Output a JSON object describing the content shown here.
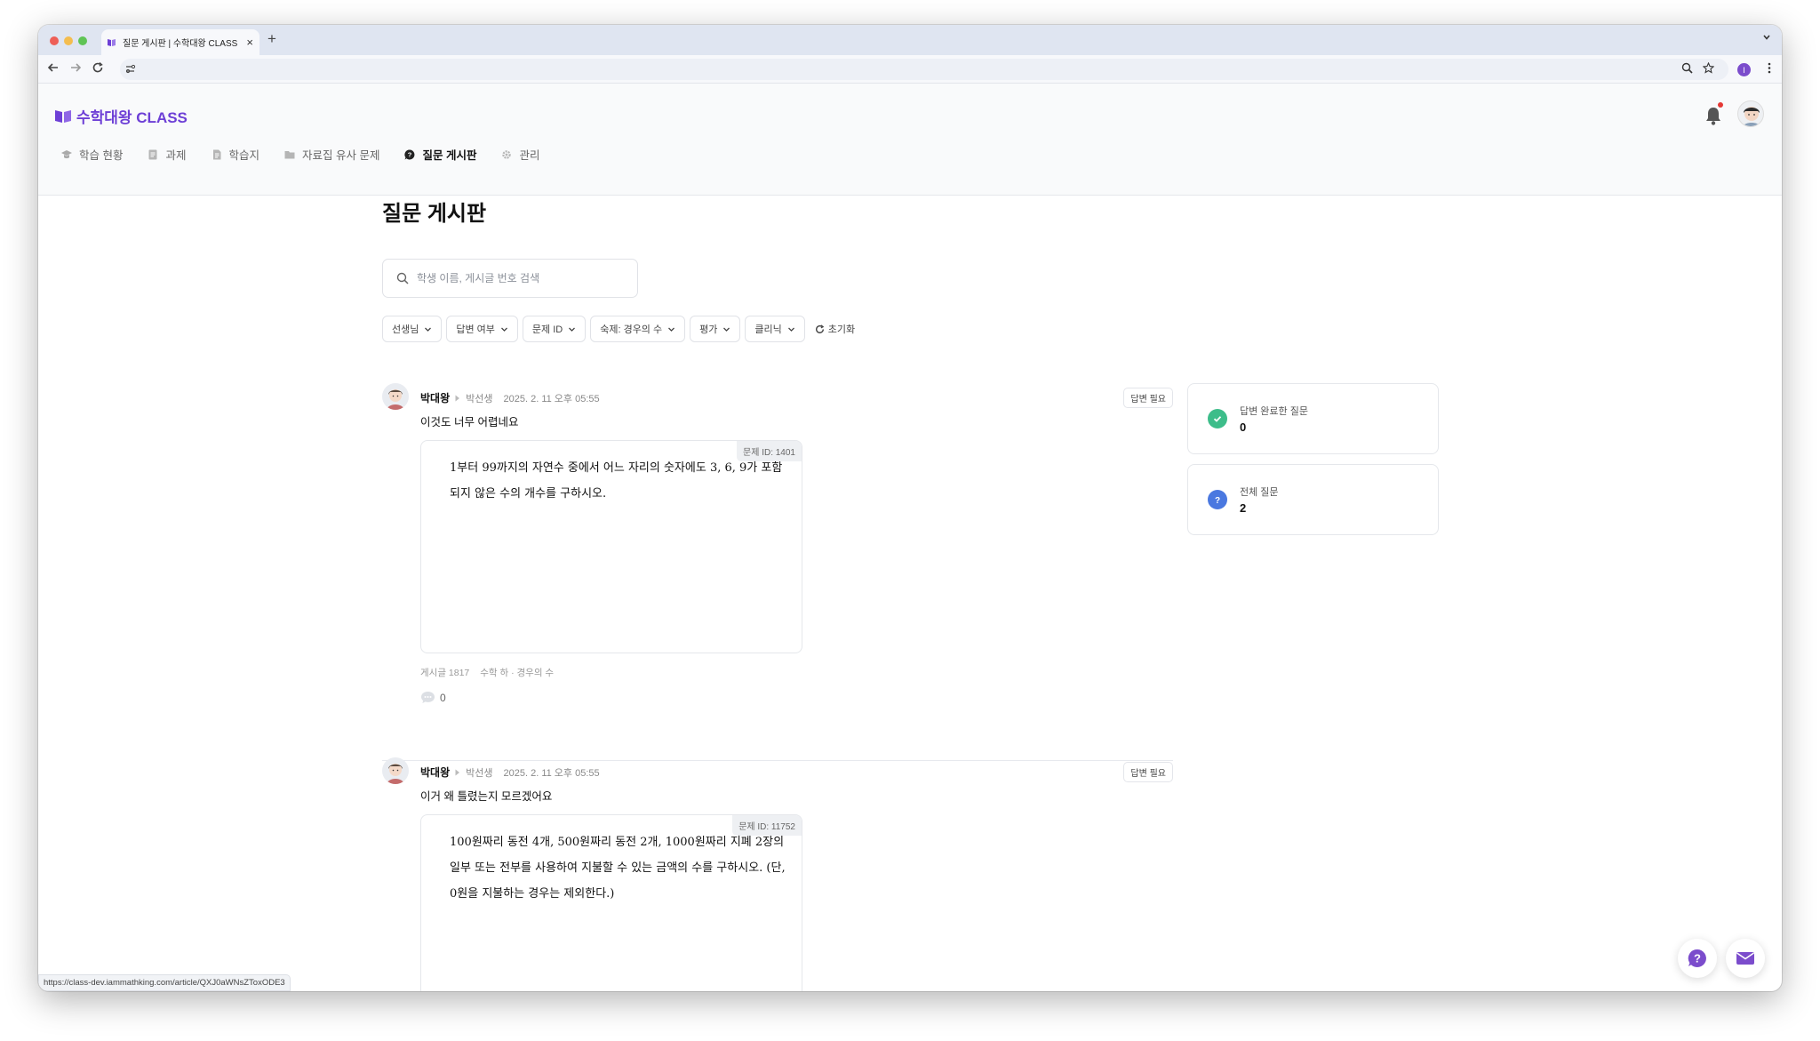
{
  "browser": {
    "tab_title": "질문 게시판 | 수학대왕 CLASS",
    "close_glyph": "×",
    "new_tab_glyph": "+",
    "status_url": "https://class-dev.iammathking.com/article/QXJ0aWNsZToxODE3",
    "profile_initial": "I"
  },
  "app": {
    "logo_text": "수학대왕 CLASS",
    "brand_color": "#6d3fd6",
    "nav": [
      {
        "label": "학습 현황",
        "icon": "graduation-cap-icon"
      },
      {
        "label": "과제",
        "icon": "document-icon"
      },
      {
        "label": "학습지",
        "icon": "worksheet-icon"
      },
      {
        "label": "자료집 유사 문제",
        "icon": "folder-icon"
      },
      {
        "label": "질문 게시판",
        "icon": "question-bubble-icon",
        "active": true
      },
      {
        "label": "관리",
        "icon": "gear-icon"
      }
    ]
  },
  "page": {
    "title": "질문 게시판",
    "search_placeholder": "학생 이름, 게시글 번호 검색",
    "filters": [
      "선생님",
      "답변 여부",
      "문제 ID",
      "숙제: 경우의 수",
      "평가",
      "클리닉"
    ],
    "reset_label": "초기화"
  },
  "posts": [
    {
      "author": "박대왕",
      "teacher": "박선생",
      "date": "2025. 2. 11 오후 05:55",
      "badge": "답변 필요",
      "text": "이것도 너무 어렵네요",
      "problem_id": "문제 ID: 1401",
      "problem_text": "1부터 99까지의 자연수 중에서 어느 자리의 숫자에도 3, 6, 9가 포함되지 않은 수의 개수를 구하시오.",
      "post_no": "게시글 1817",
      "category": "수학 하 · 경우의 수",
      "comments": "0"
    },
    {
      "author": "박대왕",
      "teacher": "박선생",
      "date": "2025. 2. 11 오후 05:55",
      "badge": "답변 필요",
      "text": "이거 왜 틀렸는지 모르겠어요",
      "problem_id": "문제 ID: 11752",
      "problem_text": "100원짜리 동전 4개, 500원짜리 동전 2개, 1000원짜리 지폐 2장의 일부 또는 전부를 사용하여 지불할 수 있는 금액의 수를 구하시오. (단, 0원을 지불하는 경우는 제외한다.)"
    }
  ],
  "stats": [
    {
      "label": "답변 완료한 질문",
      "value": "0",
      "icon": "check-circle-icon",
      "color": "#3dbd8a"
    },
    {
      "label": "전체 질문",
      "value": "2",
      "icon": "question-circle-icon",
      "color": "#4a78e0"
    }
  ]
}
